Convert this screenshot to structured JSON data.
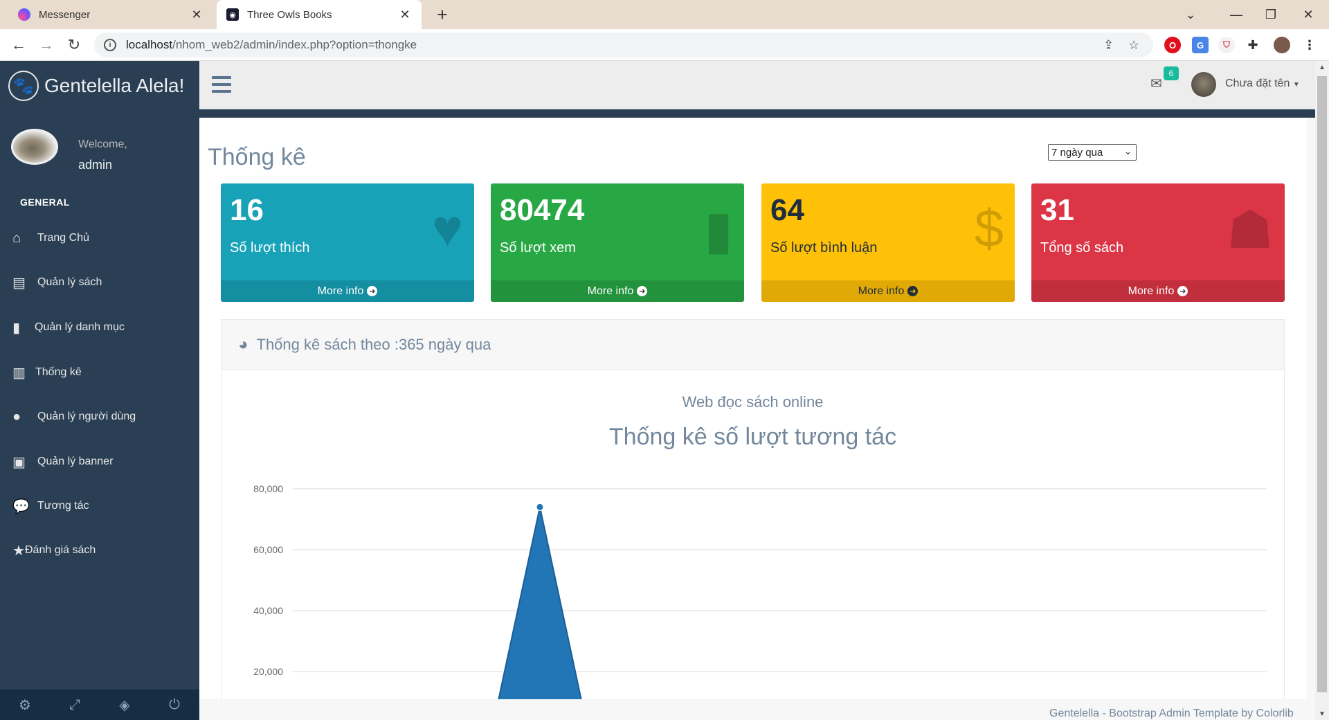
{
  "browser": {
    "tabs": [
      {
        "title": "Messenger",
        "icon": "messenger-icon",
        "active": false
      },
      {
        "title": "Three Owls Books",
        "icon": "owl-icon",
        "active": true
      }
    ],
    "url_host": "localhost",
    "url_path": "/nhom_web2/admin/index.php?option=thongke"
  },
  "sidebar": {
    "brand": "Gentelella Alela!",
    "welcome": "Welcome,",
    "username": "admin",
    "section": "GENERAL",
    "items": [
      {
        "label": "Trang Chủ",
        "icon": "home-icon"
      },
      {
        "label": "Quản lý sách",
        "icon": "book-icon"
      },
      {
        "label": "Quản lý danh mục",
        "icon": "bookmark-icon"
      },
      {
        "label": "Thống kê",
        "icon": "bar-chart-icon"
      },
      {
        "label": "Quản lý người dùng",
        "icon": "user-icon"
      },
      {
        "label": "Quản lý banner",
        "icon": "image-icon"
      },
      {
        "label": "Tương tác",
        "icon": "comments-icon"
      },
      {
        "label": "Đánh giá sách",
        "icon": "star-icon"
      }
    ],
    "footer_icons": [
      "settings-icon",
      "fullscreen-icon",
      "lock-icon",
      "logout-icon"
    ]
  },
  "topnav": {
    "mail_badge": "6",
    "user_name": "Chưa đặt tên"
  },
  "main": {
    "title": "Thống kê",
    "period_selected": "7 ngày qua",
    "stats": [
      {
        "value": "16",
        "label": "Số lượt thích",
        "footer": "More info",
        "color": "#17a2b8",
        "icon": "heart-icon"
      },
      {
        "value": "80474",
        "label": "Số lượt xem",
        "footer": "More info",
        "color": "#28a745",
        "icon": "bar-chart-icon"
      },
      {
        "value": "64",
        "label": "Số lượt bình luận",
        "footer": "More info",
        "color": "#ffc107",
        "icon": "comments-dollar-icon"
      },
      {
        "value": "31",
        "label": "Tổng số sách",
        "footer": "More info",
        "color": "#dc3545",
        "icon": "book-reader-icon"
      }
    ],
    "panel_title": "Thống kê sách theo :365 ngày qua"
  },
  "chart_data": {
    "type": "area",
    "subtitle": "Web đọc sách online",
    "title": "Thống kê số lượt tương tác",
    "xlabel": "",
    "ylabel": "",
    "ylim": [
      0,
      80000
    ],
    "y_ticks": [
      "80,000",
      "60,000",
      "40,000",
      "20,000"
    ],
    "series": [
      {
        "values": [
          0,
          0,
          0,
          0,
          74000,
          0,
          0,
          0,
          0,
          0,
          0,
          0,
          0,
          0,
          0,
          0
        ],
        "color": "#2276b6"
      }
    ],
    "grid": true
  },
  "footer": "Gentelella - Bootstrap Admin Template by Colorlib"
}
